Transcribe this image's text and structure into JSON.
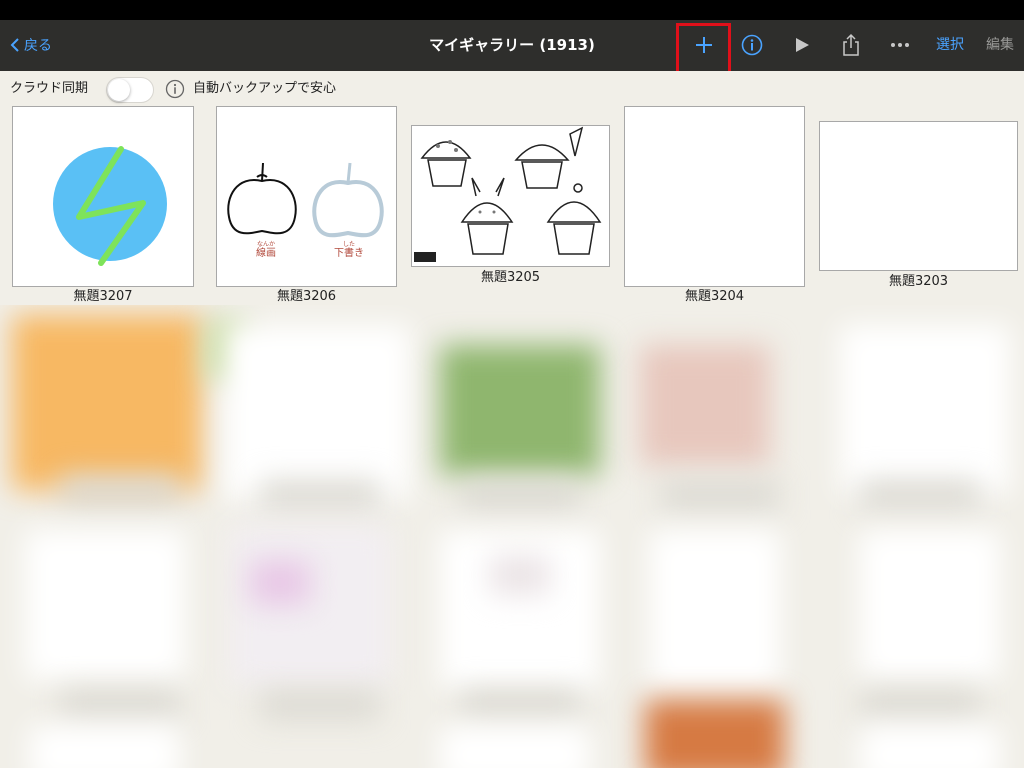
{
  "navbar": {
    "back_label": "戻る",
    "title": "マイギャラリー (1913)",
    "select_label": "選択",
    "edit_label": "編集",
    "icons": [
      "plus-icon",
      "info-icon",
      "play-icon",
      "share-icon",
      "more-icon"
    ]
  },
  "toolbar": {
    "cloud_sync_label": "クラウド同期",
    "cloud_sync_on": false,
    "backup_label": "自動バックアップで安心"
  },
  "gallery": {
    "items": [
      {
        "title": "無題3207"
      },
      {
        "title": "無題3206",
        "note_left_small": "なんか",
        "note_left": "線画",
        "note_right_small": "した",
        "note_right": "下書き"
      },
      {
        "title": "無題3205"
      },
      {
        "title": "無題3204"
      },
      {
        "title": "無題3203"
      }
    ]
  },
  "colors": {
    "accent": "#4aa3ff",
    "navbar_bg": "#2e2e2c",
    "highlight": "#e0101a",
    "background": "#f1efe8",
    "globe_blue": "#5ac0f5",
    "stroke_green": "#7ee35a"
  }
}
